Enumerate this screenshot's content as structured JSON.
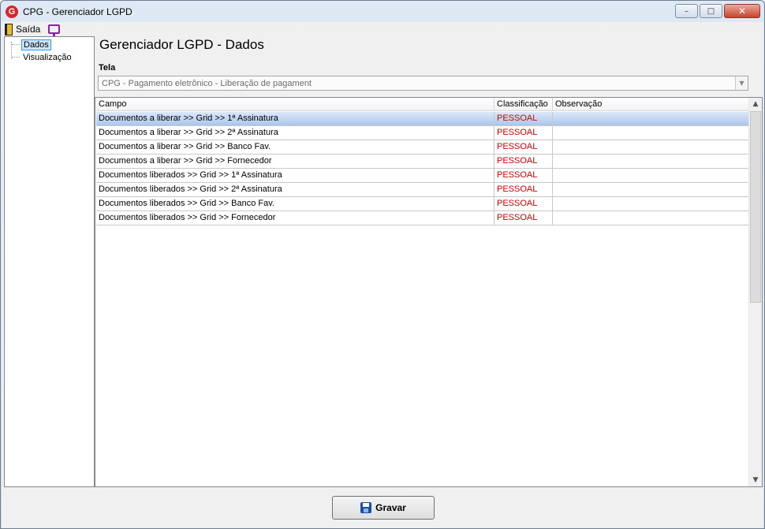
{
  "window": {
    "title": "CPG - Gerenciador LGPD",
    "icon": "app-logo-icon"
  },
  "menu": {
    "exit_label": "Saída",
    "exit_icon": "door-icon",
    "monitor_icon": "monitor-icon"
  },
  "tree": {
    "items": [
      {
        "label": "Dados",
        "selected": true
      },
      {
        "label": "Visualização",
        "selected": false
      }
    ]
  },
  "main": {
    "title": "Gerenciador LGPD - Dados",
    "tela_label": "Tela",
    "tela_value": "CPG - Pagamento eletrônico - Liberação de pagament"
  },
  "grid": {
    "columns": [
      "Campo",
      "Classificação",
      "Observação"
    ],
    "rows": [
      {
        "campo": "Documentos a liberar >> Grid >> 1ª Assinatura",
        "classificacao": "PESSOAL",
        "observacao": ""
      },
      {
        "campo": "Documentos a liberar >> Grid >> 2ª Assinatura",
        "classificacao": "PESSOAL",
        "observacao": ""
      },
      {
        "campo": "Documentos a liberar >> Grid >> Banco Fav.",
        "classificacao": "PESSOAL",
        "observacao": ""
      },
      {
        "campo": "Documentos a liberar >> Grid >> Fornecedor",
        "classificacao": "PESSOAL",
        "observacao": ""
      },
      {
        "campo": "Documentos liberados >> Grid >> 1ª Assinatura",
        "classificacao": "PESSOAL",
        "observacao": ""
      },
      {
        "campo": "Documentos liberados >> Grid >> 2ª Assinatura",
        "classificacao": "PESSOAL",
        "observacao": ""
      },
      {
        "campo": "Documentos liberados >> Grid >> Banco Fav.",
        "classificacao": "PESSOAL",
        "observacao": ""
      },
      {
        "campo": "Documentos liberados >> Grid >> Fornecedor",
        "classificacao": "PESSOAL",
        "observacao": ""
      }
    ],
    "selected_row": 0,
    "classification_color": "#d00000"
  },
  "footer": {
    "save_label": "Gravar",
    "save_icon": "floppy-disk-icon"
  }
}
